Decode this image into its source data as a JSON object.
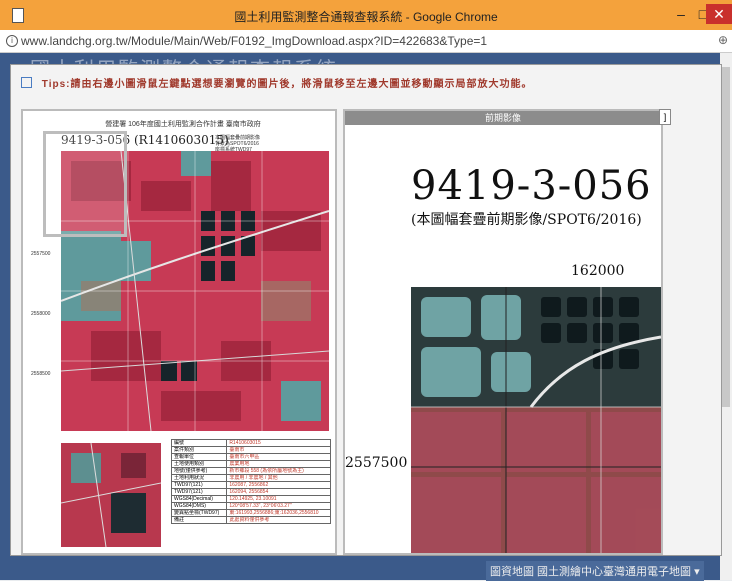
{
  "window": {
    "title": "國土利用監測整合通報查報系統 - Google Chrome",
    "url": "www.landchg.org.tw/Module/Main/Web/F0192_ImgDownload.aspx?ID=422683&Type=1"
  },
  "background": {
    "header": "國土利用監測整合通報查報系統",
    "footer": "圖資地圖 國土測繪中心臺灣通用電子地圖 ▾"
  },
  "modal": {
    "tips": "Tips:請由右邊小圖滑鼠左鍵點選想要瀏覽的圖片後，將滑鼠移至左邊大圖並移動顯示局部放大功能。",
    "right_pane_header": "前期影像",
    "extra_button": "]"
  },
  "left_doc": {
    "header": "營建署 106年度國土利用監測合作計畫 臺南市政府",
    "code": "9419-3-056 (R1410603015)",
    "notes": [
      "本圖幅套疊前期影像",
      "背景為SPOT6/2016",
      "座標系統TWD97"
    ],
    "y_labels": [
      "2557500",
      "2558000",
      "2558500"
    ],
    "info_rows": [
      [
        "編號",
        "R1410603015"
      ],
      [
        "案件類別",
        "臺南市"
      ],
      [
        "查報單位",
        "臺南市六甲區"
      ],
      [
        "土地使用類別",
        "農業用地"
      ],
      [
        "地號(僅供參考)",
        "新市鄉段 558 (為依所屬地號為主)"
      ],
      [
        "土地利用狀況",
        "非農用 / 非農地 / 其他"
      ],
      [
        "TWD97(121)",
        "162087, 2556862"
      ],
      [
        "TWD97(121)",
        "162094, 2556854"
      ],
      [
        "WGS84(Decimal)",
        "120.14925, 23.10091"
      ],
      [
        "WGS84(DMS)",
        "120°08'57.33\", 23°06'03.27\""
      ],
      [
        "變異點坐標(TWD97)",
        "東:161993,2556886;東:162036,2556810"
      ],
      [
        "備註",
        "此處資料僅供參考"
      ]
    ]
  },
  "right_doc": {
    "code": "9419-3-056",
    "caption": "(本圖幅套疊前期影像/SPOT6/2016)",
    "x_coord": "162000",
    "y_coord": "2557500"
  },
  "icons": {
    "page": "page-icon",
    "info": "info-icon",
    "zoom": "zoom-icon",
    "tips_checkbox": "checkbox-icon"
  }
}
